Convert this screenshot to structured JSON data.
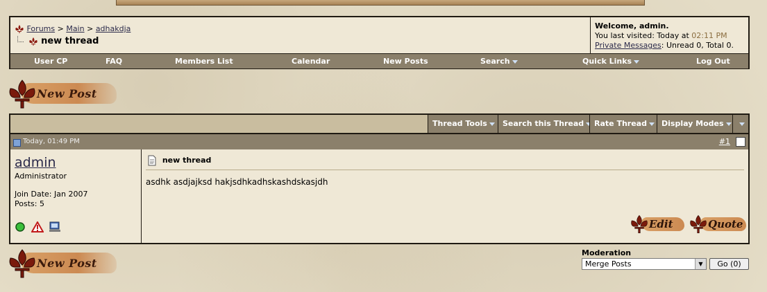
{
  "breadcrumb": {
    "forums": "Forums",
    "sep1": ">",
    "main": "Main",
    "sep2": ">",
    "forum": "adhakdja"
  },
  "thread_title": "new thread",
  "welcome": {
    "greeting": "Welcome, admin.",
    "last_visited_prefix": "You last visited: Today at",
    "last_visited_time": "02:11 PM",
    "pm_link": "Private Messages",
    "pm_stats": ": Unread 0, Total 0."
  },
  "nav": {
    "user_cp": "User CP",
    "faq": "FAQ",
    "members": "Members List",
    "calendar": "Calendar",
    "new_posts": "New Posts",
    "search": "Search",
    "quick_links": "Quick Links",
    "log_out": "Log Out"
  },
  "new_post_label": "New Post",
  "tools": {
    "thread_tools": "Thread Tools",
    "search_thread": "Search this Thread",
    "rate_thread": "Rate Thread",
    "display_modes": "Display Modes"
  },
  "post": {
    "date": "Today, 01:49 PM",
    "number": "#1",
    "username": "admin",
    "role": "Administrator",
    "join_date": "Join Date: Jan 2007",
    "posts": "Posts: 5",
    "title": "new thread",
    "body": "asdhk asdjajksd hakjsdhkadhskashdskasjdh",
    "edit_label": "Edit",
    "quote_label": "Quote"
  },
  "moderation": {
    "label": "Moderation",
    "selected": "Merge Posts",
    "go": "Go (0)"
  }
}
